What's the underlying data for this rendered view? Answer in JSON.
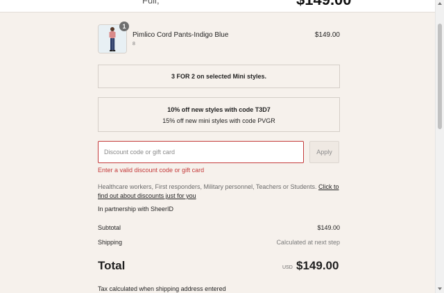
{
  "topbar": {
    "left_fragment": "Full, ",
    "total_fragment": "$149.00"
  },
  "product": {
    "quantity": "1",
    "name": "Pimlico Cord Pants-Indigo Blue",
    "variant": "8",
    "price": "$149.00"
  },
  "promotions": {
    "promo1_line1": "3 FOR 2 on selected Mini styles.",
    "promo2_line1": "10% off new styles with code T3D7",
    "promo2_line2": "15% off new mini styles with code PVGR"
  },
  "discount": {
    "placeholder": "Discount code or gift card",
    "value": "",
    "apply_label": "Apply",
    "error": "Enter a valid discount code or gift card"
  },
  "healthcare": {
    "text": "Healthcare workers, First responders, Military personnel, Teachers or Students. ",
    "link_text": "Click to find out about discounts just for you",
    "partnership": "In partnership with SheerID"
  },
  "summary": {
    "subtotal_label": "Subtotal",
    "subtotal_value": "$149.00",
    "shipping_label": "Shipping",
    "shipping_value": "Calculated at next step",
    "total_label": "Total",
    "total_currency": "USD",
    "total_amount": "$149.00",
    "tax_note": "Tax calculated when shipping address entered"
  }
}
